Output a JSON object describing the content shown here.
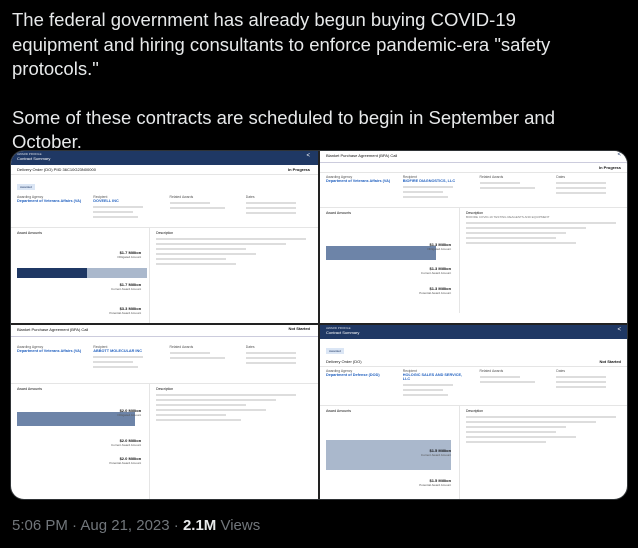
{
  "tweet": {
    "para1": "The federal government has already begun buying COVID-19 equipment and hiring consultants to enforce pandemic-era \"safety protocols.\"",
    "para2": "Some of these contracts are scheduled to begin in September and October."
  },
  "panels": {
    "tl": {
      "header_small": "AWARD PROFILE",
      "header_title": "Contract Summary",
      "order": "Delivery Order (DO)  PIID 36C10G23N00000",
      "status": "In Progress",
      "badge": "Awarded",
      "agency_label": "Awarding Agency",
      "agency": "Department of Veterans Affairs (VA)",
      "recipient_label": "Recipient",
      "recipient": "DOVEELL INC",
      "related_label": "Related Awards",
      "dates_label": "Dates",
      "amounts_label": "Award Amounts",
      "desc_label": "Description",
      "amt1": "$1.7 Million",
      "amt1_label": "Obligated Amount",
      "amt2": "$1.7 Million",
      "amt2_label": "Current Award Amount",
      "amt3": "$3.3 Million",
      "amt3_label": "Potential Award Amount"
    },
    "tr": {
      "header_title": "Blanket Purchase Agreement (BPA) Call",
      "status": "In Progress",
      "agency_label": "Awarding Agency",
      "agency": "Department of Veterans Affairs (VA)",
      "recipient_label": "Recipient",
      "recipient": "BIOFIRE DIAGNOSTICS, LLC",
      "related_label": "Related Awards",
      "dates_label": "Dates",
      "amounts_label": "Award Amounts",
      "desc_label": "Description",
      "desc_text": "BIOFIRE COVID-19 TESTING REAGENTS AND EQUIPMENT",
      "amt1": "$1.3 Million",
      "amt1_label": "Obligated Amount",
      "amt2": "$1.3 Million",
      "amt2_label": "Current Award Amount",
      "amt3": "$1.3 Million",
      "amt3_label": "Potential Award Amount"
    },
    "bl": {
      "header_title": "Blanket Purchase Agreement (BPA) Call",
      "status": "Not Started",
      "agency_label": "Awarding Agency",
      "agency": "Department of Veterans Affairs (VA)",
      "recipient_label": "Recipient",
      "recipient": "ABBOTT MOLECULAR INC",
      "related_label": "Related Awards",
      "dates_label": "Dates",
      "amounts_label": "Award Amounts",
      "desc_label": "Description",
      "amt1": "$2.0 Million",
      "amt1_label": "Obligated Amount",
      "amt2": "$2.0 Million",
      "amt2_label": "Current Award Amount",
      "amt3": "$2.0 Million",
      "amt3_label": "Potential Award Amount"
    },
    "br": {
      "header_small": "AWARD PROFILE",
      "header_title": "Contract Summary",
      "order": "Delivery Order (DO)",
      "status": "Not Started",
      "badge": "Awarded",
      "agency_label": "Awarding Agency",
      "agency": "Department of Defense (DOD)",
      "recipient_label": "Recipient",
      "recipient": "HOLOGIC SALES AND SERVICE, LLC",
      "related_label": "Related Awards",
      "dates_label": "Dates",
      "amounts_label": "Award Amounts",
      "desc_label": "Description",
      "amt1": "$1.5 Million",
      "amt1_label": "Current Award Amount",
      "amt2": "$1.5 Million",
      "amt2_label": "Potential Award Amount"
    }
  },
  "footer": {
    "time": "5:06 PM · Aug 21, 2023 · ",
    "views_count": "2.1M",
    "views_label": " Views"
  }
}
